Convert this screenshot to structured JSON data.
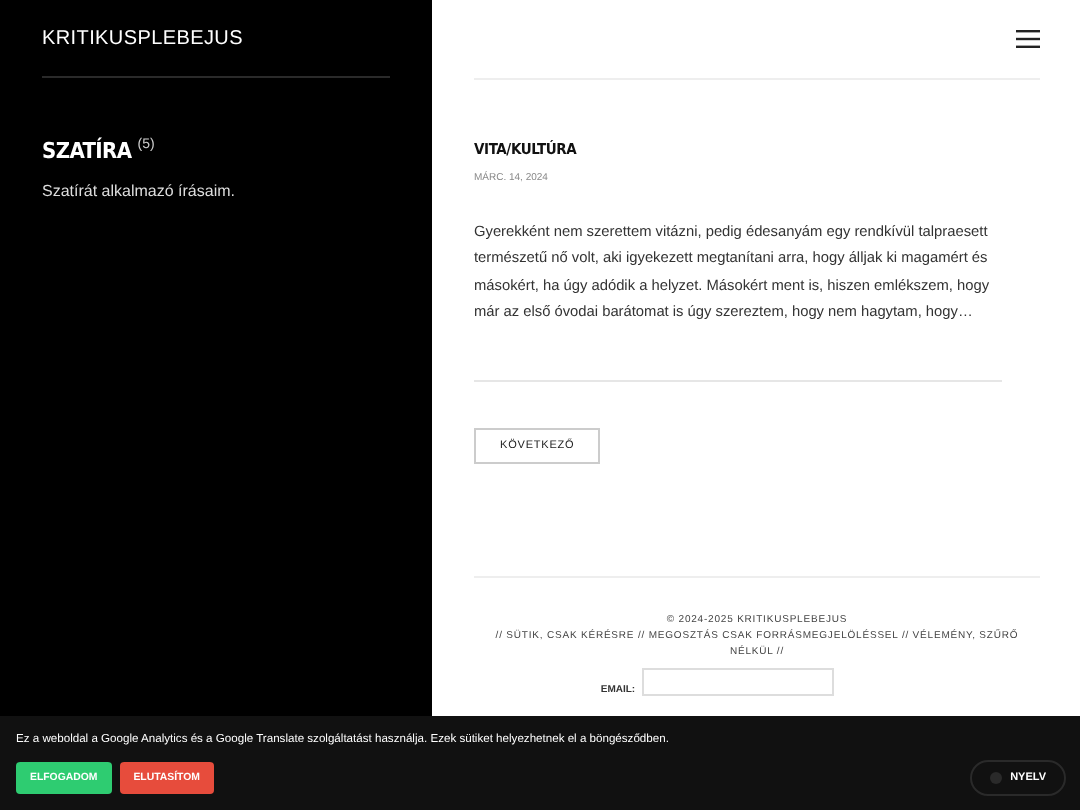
{
  "sidebar": {
    "site_title": "KRITIKUSPLEBEJUS",
    "category": {
      "title": "SZATÍRA",
      "count": "(5)",
      "description": "Szatírát alkalmazó írásaim."
    }
  },
  "post": {
    "category": "VITA/KULTÚRA",
    "date": "MÁRC. 14, 2024",
    "excerpt": "Gyerekként nem szerettem vitázni, pedig édesanyám egy rendkívül talpraesett természetű nő volt, aki igyekezett megtanítani arra, hogy álljak ki magamért és másokért, ha úgy adódik a helyzet. Másokért ment is, hiszen emlékszem, hogy már az első óvodai barátomat is úgy szereztem, hogy nem hagytam, hogy…"
  },
  "pagination": {
    "next": "KÖVETKEZŐ"
  },
  "footer": {
    "copyright": "© 2024-2025 KRITIKUSPLEBEJUS",
    "motto": "// SÜTIK, CSAK KÉRÉSRE // MEGOSZTÁS CSAK FORRÁSMEGJELÖLÉSSEL // VÉLEMÉNY, SZŰRŐ NÉLKÜL //",
    "email_label": "EMAIL:"
  },
  "cookie_bar": {
    "message": "Ez a weboldal a Google Analytics és a Google Translate szolgáltatást használja. Ezek sütiket helyezhetnek el a böngésződben.",
    "buttons": [
      {
        "label": "ELFOGADOM",
        "kind": "accept"
      },
      {
        "label": "ELUTASÍTOM",
        "kind": "reject"
      }
    ],
    "language": "NYELV"
  }
}
